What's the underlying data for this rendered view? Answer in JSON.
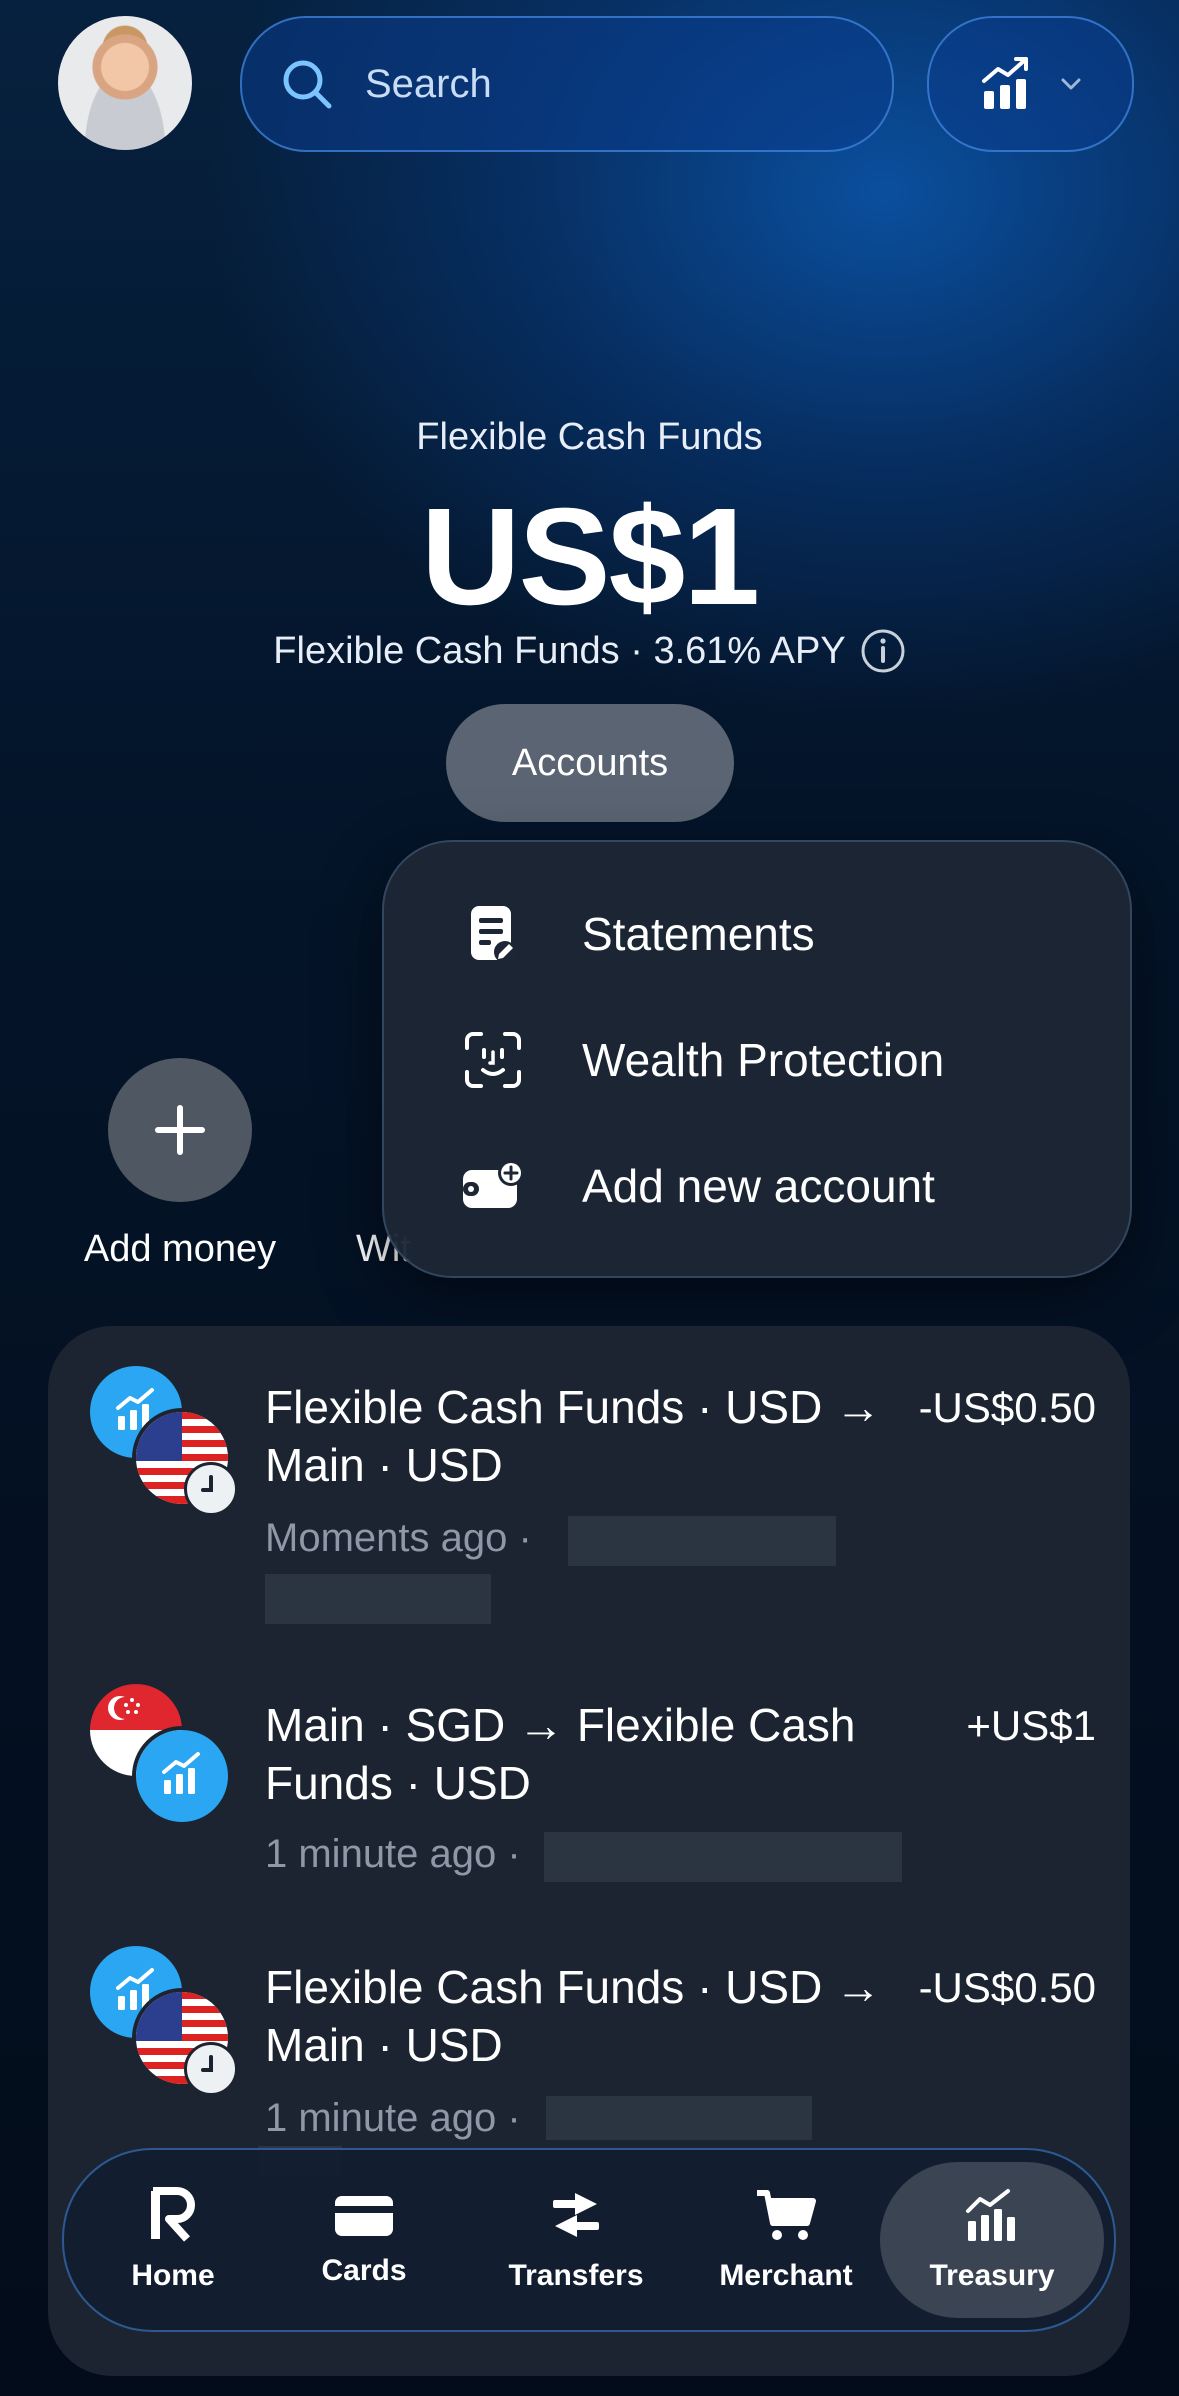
{
  "header": {
    "search_placeholder": "Search",
    "analytics_icon": "chart-up-icon"
  },
  "hero": {
    "subtitle": "Flexible Cash Funds",
    "amount": "US$1",
    "account_line": "Flexible Cash Funds · 3.61% APY",
    "accounts_button": "Accounts"
  },
  "menu": {
    "items": [
      {
        "label": "Statements",
        "icon": "statement-icon"
      },
      {
        "label": "Wealth Protection",
        "icon": "face-scan-icon"
      },
      {
        "label": "Add new account",
        "icon": "add-wallet-icon"
      }
    ]
  },
  "actions": {
    "add_money": "Add money",
    "withdraw_partial": "Wit"
  },
  "transactions": [
    {
      "title": "Flexible Cash Funds · USD → Main · USD",
      "amount": "-US$0.50",
      "time": "Moments ago ·"
    },
    {
      "title": "Main · SGD → Flexible Cash Funds · USD",
      "amount": "+US$1",
      "time": "1 minute ago ·"
    },
    {
      "title": "Flexible Cash Funds · USD → Main · USD",
      "amount": "-US$0.50",
      "time": "1 minute ago ·"
    }
  ],
  "nav": {
    "items": [
      {
        "label": "Home"
      },
      {
        "label": "Cards"
      },
      {
        "label": "Transfers"
      },
      {
        "label": "Merchant"
      },
      {
        "label": "Treasury"
      }
    ],
    "active": "Treasury"
  },
  "colors": {
    "accent_blue": "#2aa6f3",
    "card_bg": "#1b2430"
  }
}
